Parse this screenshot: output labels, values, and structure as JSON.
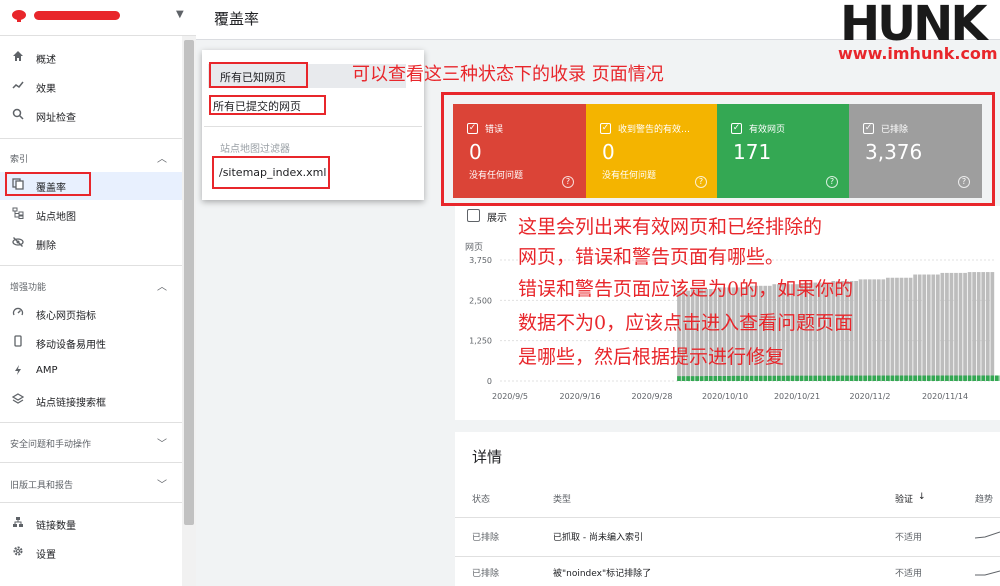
{
  "header": {
    "title": "覆盖率"
  },
  "logo": {
    "brand": "HUNK",
    "url": "www.imhunk.com"
  },
  "sidebar": {
    "top_items": [
      {
        "label": "概述",
        "icon": "home-icon"
      },
      {
        "label": "效果",
        "icon": "trending-icon"
      },
      {
        "label": "网址检查",
        "icon": "search-icon"
      }
    ],
    "sections": [
      {
        "title": "索引",
        "items": [
          {
            "label": "覆盖率",
            "icon": "copy-icon",
            "active": true
          },
          {
            "label": "站点地图",
            "icon": "sitemap-icon"
          },
          {
            "label": "删除",
            "icon": "hide-icon"
          }
        ]
      },
      {
        "title": "增强功能",
        "items": [
          {
            "label": "核心网页指标",
            "icon": "gauge-icon"
          },
          {
            "label": "移动设备易用性",
            "icon": "phone-icon"
          },
          {
            "label": "AMP",
            "icon": "bolt-icon"
          },
          {
            "label": "站点链接搜索框",
            "icon": "layers-icon"
          }
        ]
      },
      {
        "title": "安全问题和手动操作",
        "items": []
      },
      {
        "title": "旧版工具和报告",
        "items": []
      }
    ],
    "bottom_items": [
      {
        "label": "链接数量",
        "icon": "network-icon"
      },
      {
        "label": "设置",
        "icon": "gear-icon"
      }
    ]
  },
  "filter": {
    "all_known": "所有已知网页",
    "all_submitted": "所有已提交的网页",
    "sitemap_caption": "站点地图过滤器",
    "sitemap_file": "/sitemap_index.xml"
  },
  "cards": [
    {
      "label": "错误",
      "value": "0",
      "sub": "没有任何问题",
      "color": "#db4437"
    },
    {
      "label": "收到警告的有效…",
      "value": "0",
      "sub": "没有任何问题",
      "color": "#f4b400"
    },
    {
      "label": "有效网页",
      "value": "171",
      "sub": "",
      "color": "#34a853"
    },
    {
      "label": "已排除",
      "value": "3,376",
      "sub": "",
      "color": "#9e9e9e"
    }
  ],
  "chart": {
    "show_label": "展示"
  },
  "chart_data": {
    "type": "bar",
    "ylabel": "网页",
    "yticks": [
      "3,750",
      "2,500",
      "1,250",
      "0"
    ],
    "ylim": [
      0,
      3750
    ],
    "xticks": [
      "2020/9/5",
      "2020/9/16",
      "2020/9/28",
      "2020/10/10",
      "2020/10/21",
      "2020/11/2",
      "2020/11/14"
    ],
    "series": [
      {
        "name": "已排除",
        "color": "#bdbdbd",
        "values": [
          0,
          0,
          0,
          0,
          0,
          0,
          0,
          0,
          0,
          0,
          0,
          0,
          0,
          0,
          0,
          0,
          0,
          0,
          0,
          0,
          0,
          0,
          0,
          0,
          0,
          0,
          0,
          0,
          0,
          0,
          0,
          0,
          0,
          0,
          0,
          0,
          0,
          0,
          0,
          2800,
          2800,
          2800,
          2850,
          2850,
          2850,
          2850,
          2850,
          2850,
          2900,
          2900,
          2900,
          2900,
          2900,
          2900,
          2950,
          2950,
          2950,
          2950,
          2950,
          2950,
          3000,
          3000,
          3000,
          3000,
          3000,
          3000,
          3000,
          3050,
          3050,
          3050,
          3050,
          3050,
          3050,
          3100,
          3100,
          3100,
          3100,
          3100,
          3100,
          3150,
          3150,
          3150,
          3150,
          3150,
          3150,
          3200,
          3200,
          3200,
          3200,
          3200,
          3200,
          3300,
          3300,
          3300,
          3300,
          3300,
          3300,
          3350,
          3350,
          3350,
          3350,
          3350,
          3350,
          3376,
          3376,
          3376,
          3376,
          3376,
          3376
        ]
      },
      {
        "name": "有效网页",
        "color": "#34a853",
        "values": [
          0,
          0,
          0,
          0,
          0,
          0,
          0,
          0,
          0,
          0,
          0,
          0,
          0,
          0,
          0,
          0,
          0,
          0,
          0,
          0,
          0,
          0,
          0,
          0,
          0,
          0,
          0,
          0,
          0,
          0,
          0,
          0,
          0,
          0,
          0,
          0,
          0,
          0,
          0,
          150,
          150,
          150,
          150,
          150,
          150,
          155,
          155,
          155,
          155,
          155,
          155,
          160,
          160,
          160,
          160,
          160,
          160,
          162,
          162,
          162,
          162,
          162,
          162,
          165,
          165,
          165,
          165,
          165,
          165,
          166,
          166,
          166,
          166,
          166,
          166,
          168,
          168,
          168,
          168,
          168,
          168,
          169,
          169,
          169,
          169,
          169,
          169,
          170,
          170,
          170,
          170,
          170,
          170,
          170,
          170,
          170,
          170,
          170,
          170,
          171,
          171,
          171,
          171,
          171,
          171,
          171,
          171,
          171,
          171,
          171,
          171
        ]
      }
    ]
  },
  "annotations": {
    "top": "可以查看这三种状态下的收录 页面情况",
    "lines": [
      "这里会列出来有效网页和已经排除的",
      "网页，错误和警告页面有哪些。",
      "错误和警告页面应该是为0的，如果你的",
      "数据不为0，应该点击进入查看问题页面",
      "是哪些，然后根据提示进行修复"
    ]
  },
  "details": {
    "title": "详情",
    "columns": [
      "状态",
      "类型",
      "验证",
      "趋势"
    ],
    "sort_icon": "↓",
    "rows": [
      {
        "status": "已排除",
        "type": "已抓取 - 尚未编入索引",
        "validation": "不适用"
      },
      {
        "status": "已排除",
        "type": "被\"noindex\"标记排除了",
        "validation": "不适用"
      }
    ]
  }
}
